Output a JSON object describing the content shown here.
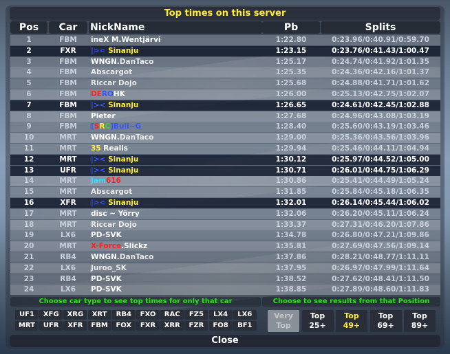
{
  "title": "Top times on this server",
  "columns": {
    "pos": "Pos",
    "car": "Car",
    "nick": "NickName",
    "pb": "Pb",
    "splits": "Splits"
  },
  "rows": [
    {
      "pos": "1",
      "car": "FBM",
      "nick": [
        {
          "t": "ineX",
          "c": "#ffffff"
        },
        {
          "t": " M.Wentjärvi",
          "c": "#ffffff"
        }
      ],
      "pb": "1:22.80",
      "splits": "0:23.96/0:40.91/0:59.70",
      "hl": false
    },
    {
      "pos": "2",
      "car": "FXR",
      "nick": [
        {
          "t": "|><",
          "c": "#3355ff"
        },
        {
          "t": " Sinanju",
          "c": "#ffee33"
        }
      ],
      "pb": "1:23.15",
      "splits": "0:23.76/0:41.43/1:00.47",
      "hl": true
    },
    {
      "pos": "3",
      "car": "FBM",
      "nick": [
        {
          "t": "WNGN.",
          "c": "#ffffff"
        },
        {
          "t": "DanTaco",
          "c": "#e8e8e8"
        }
      ],
      "pb": "1:25.17",
      "splits": "0:24.74/0:41.92/1:01.35",
      "hl": false
    },
    {
      "pos": "4",
      "car": "FBM",
      "nick": [
        {
          "t": "Abscargot",
          "c": "#e8e8e8"
        }
      ],
      "pb": "1:25.35",
      "splits": "0:24.36/0:42.16/1:01.37",
      "hl": false
    },
    {
      "pos": "5",
      "car": "FBM",
      "nick": [
        {
          "t": "Riccar Dojo",
          "c": "#e8e8e8"
        }
      ],
      "pb": "1:25.68",
      "splits": "0:24.88/0:41.71/1:01.62",
      "hl": false
    },
    {
      "pos": "6",
      "car": "FBM",
      "nick": [
        {
          "t": "DE",
          "c": "#ff2222"
        },
        {
          "t": "RO",
          "c": "#3355ff"
        },
        {
          "t": "HK",
          "c": "#ffffff"
        }
      ],
      "pb": "1:26.00",
      "splits": "0:25.13/0:42.75/1:02.07",
      "hl": false
    },
    {
      "pos": "7",
      "car": "FBM",
      "nick": [
        {
          "t": "|><",
          "c": "#3355ff"
        },
        {
          "t": " Sinanju",
          "c": "#ffee33"
        }
      ],
      "pb": "1:26.65",
      "splits": "0:24.61/0:42.45/1:02.88",
      "hl": true
    },
    {
      "pos": "8",
      "car": "FBM",
      "nick": [
        {
          "t": "Pieter",
          "c": "#ffffff"
        }
      ],
      "pb": "1:27.68",
      "splits": "0:24.96/0:43.08/1:03.19",
      "hl": false
    },
    {
      "pos": "9",
      "car": "FBM",
      "nick": [
        {
          "t": "[",
          "c": "#3355ff"
        },
        {
          "t": "S",
          "c": "#ff2222"
        },
        {
          "t": "R",
          "c": "#ffee33"
        },
        {
          "t": "C",
          "c": "#33dd22"
        },
        {
          "t": "]",
          "c": "#3355ff"
        },
        {
          "t": "Buli",
          "c": "#3355ff"
        },
        {
          "t": "~G",
          "c": "#3355ff"
        }
      ],
      "pb": "1:28.40",
      "splits": "0:25.60/0:43.19/1:03.46",
      "hl": false
    },
    {
      "pos": "10",
      "car": "MRT",
      "nick": [
        {
          "t": "WNGN.",
          "c": "#ffffff"
        },
        {
          "t": "DanTaco",
          "c": "#e8e8e8"
        }
      ],
      "pb": "1:29.00",
      "splits": "0:25.36/0:43.56/1:03.96",
      "hl": false
    },
    {
      "pos": "11",
      "car": "MRT",
      "nick": [
        {
          "t": "35",
          "c": "#ffee33"
        },
        {
          "t": " Realis",
          "c": "#ffffff"
        }
      ],
      "pb": "1:29.94",
      "splits": "0:25.46/0:44.11/1:04.94",
      "hl": false
    },
    {
      "pos": "12",
      "car": "MRT",
      "nick": [
        {
          "t": "|><",
          "c": "#3355ff"
        },
        {
          "t": " Sinanju",
          "c": "#ffee33"
        }
      ],
      "pb": "1:30.12",
      "splits": "0:25.97/0:44.52/1:05.00",
      "hl": true
    },
    {
      "pos": "13",
      "car": "UFR",
      "nick": [
        {
          "t": "|><",
          "c": "#3355ff"
        },
        {
          "t": " Sinanju",
          "c": "#ffee33"
        }
      ],
      "pb": "1:30.71",
      "splits": "0:26.01/0:44.75/1:06.29",
      "hl": true
    },
    {
      "pos": "14",
      "car": "MRT",
      "nick": [
        {
          "t": "Jam",
          "c": "#33ddff"
        },
        {
          "t": "616",
          "c": "#ff2222"
        }
      ],
      "pb": "1:30.86",
      "splits": "0:25.41/0:44.49/1:05.24",
      "hl": false
    },
    {
      "pos": "15",
      "car": "MRT",
      "nick": [
        {
          "t": "Abscargot",
          "c": "#e8e8e8"
        }
      ],
      "pb": "1:31.85",
      "splits": "0:25.84/0:45.18/1:06.35",
      "hl": false
    },
    {
      "pos": "16",
      "car": "XFR",
      "nick": [
        {
          "t": "|><",
          "c": "#3355ff"
        },
        {
          "t": " Sinanju",
          "c": "#ffee33"
        }
      ],
      "pb": "1:32.01",
      "splits": "0:26.14/0:45.44/1:06.02",
      "hl": true
    },
    {
      "pos": "17",
      "car": "MRT",
      "nick": [
        {
          "t": "disc ~ Yörry",
          "c": "#ffffff"
        }
      ],
      "pb": "1:32.06",
      "splits": "0:26.20/0:45.11/1:06.24",
      "hl": false
    },
    {
      "pos": "18",
      "car": "MRT",
      "nick": [
        {
          "t": "Riccar Dojo",
          "c": "#e8e8e8"
        }
      ],
      "pb": "1:33.37",
      "splits": "0:27.31/0:46.20/1:07.86",
      "hl": false
    },
    {
      "pos": "19",
      "car": "LX6",
      "nick": [
        {
          "t": "PD-SVK",
          "c": "#ffffff"
        }
      ],
      "pb": "1:34.78",
      "splits": "0:26.80/0:47.21/1:09.86",
      "hl": false
    },
    {
      "pos": "20",
      "car": "MRT",
      "nick": [
        {
          "t": "X-Force",
          "c": "#ff2222"
        },
        {
          "t": ".Slickz",
          "c": "#ffffff"
        }
      ],
      "pb": "1:35.81",
      "splits": "0:27.69/0:47.56/1:09.14",
      "hl": false
    },
    {
      "pos": "21",
      "car": "RB4",
      "nick": [
        {
          "t": "WNGN.",
          "c": "#ffffff"
        },
        {
          "t": "DanTaco",
          "c": "#e8e8e8"
        }
      ],
      "pb": "1:37.86",
      "splits": "0:28.21/0:48.77/1:11.11",
      "hl": false
    },
    {
      "pos": "22",
      "car": "LX6",
      "nick": [
        {
          "t": "Juroo_SK",
          "c": "#e8e8e8"
        }
      ],
      "pb": "1:37.95",
      "splits": "0:26.97/0:47.99/1:11.64",
      "hl": false
    },
    {
      "pos": "23",
      "car": "RB4",
      "nick": [
        {
          "t": "PD-SVK",
          "c": "#ffffff"
        }
      ],
      "pb": "1:38.52",
      "splits": "0:27.62/0:48.41/1:11.50",
      "hl": false
    },
    {
      "pos": "24",
      "car": "LX6",
      "nick": [
        {
          "t": "PD-SVK",
          "c": "#ffffff"
        }
      ],
      "pb": "1:38.85",
      "splits": "0:27.89/0:48.60/1:11.83",
      "hl": false
    }
  ],
  "car_hint": "Choose car type to see top times for only that car",
  "pos_hint": "Choose to see results from that Position",
  "cars_row1": [
    "UF1",
    "XFG",
    "XRG",
    "XRT",
    "RB4",
    "FXO",
    "RAC",
    "FZ5",
    "LX4",
    "LX6"
  ],
  "cars_row2": [
    "MRT",
    "UFR",
    "XFR",
    "FBM",
    "FOX",
    "FXR",
    "XRR",
    "FZR",
    "FO8",
    "BF1"
  ],
  "pos_buttons": [
    {
      "l1": "Very",
      "l2": "Top",
      "state": "disabled"
    },
    {
      "l1": "Top",
      "l2": "25+",
      "state": "normal"
    },
    {
      "l1": "Top",
      "l2": "49+",
      "state": "selected"
    },
    {
      "l1": "Top",
      "l2": "69+",
      "state": "normal"
    },
    {
      "l1": "Top",
      "l2": "89+",
      "state": "normal"
    }
  ],
  "close_label": "Close"
}
